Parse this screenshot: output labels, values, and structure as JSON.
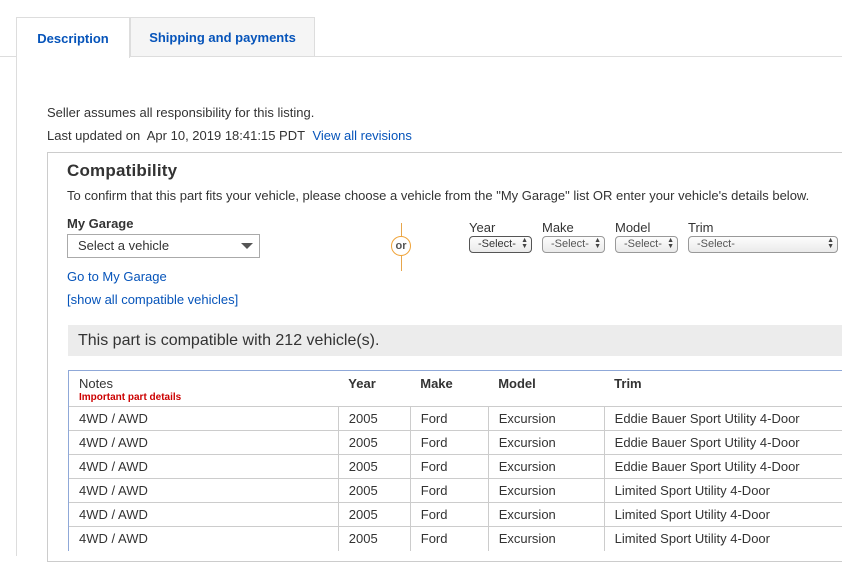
{
  "tabs": [
    {
      "label": "Description",
      "active": true
    },
    {
      "label": "Shipping and payments",
      "active": false
    }
  ],
  "seller_note": "Seller assumes all responsibility for this listing.",
  "last_updated": {
    "label": "Last updated on",
    "value": "Apr 10, 2019 18:41:15 PDT",
    "link": "View all revisions"
  },
  "compatibility": {
    "title": "Compatibility",
    "description": "To confirm that this part fits your vehicle, please choose a vehicle from the \"My Garage\" list OR enter your vehicle's details below.",
    "garage_label": "My Garage",
    "garage_placeholder": "Select a vehicle",
    "goto_link": "Go to My Garage",
    "show_all_link": "[show all compatible vehicles]",
    "or_text": "or",
    "selectors": [
      {
        "label": "Year",
        "value": "-Select-"
      },
      {
        "label": "Make",
        "value": "-Select-"
      },
      {
        "label": "Model",
        "value": "-Select-"
      },
      {
        "label": "Trim",
        "value": "-Select-"
      }
    ],
    "banner": "This part is compatible with 212 vehicle(s).",
    "table": {
      "headers": {
        "notes": "Notes",
        "notes_sub": "Important part details",
        "year": "Year",
        "make": "Make",
        "model": "Model",
        "trim": "Trim"
      },
      "rows": [
        {
          "notes": "4WD / AWD",
          "year": "2005",
          "make": "Ford",
          "model": "Excursion",
          "trim": "Eddie Bauer Sport Utility 4-Door"
        },
        {
          "notes": "4WD / AWD",
          "year": "2005",
          "make": "Ford",
          "model": "Excursion",
          "trim": "Eddie Bauer Sport Utility 4-Door"
        },
        {
          "notes": "4WD / AWD",
          "year": "2005",
          "make": "Ford",
          "model": "Excursion",
          "trim": "Eddie Bauer Sport Utility 4-Door"
        },
        {
          "notes": "4WD / AWD",
          "year": "2005",
          "make": "Ford",
          "model": "Excursion",
          "trim": "Limited Sport Utility 4-Door"
        },
        {
          "notes": "4WD / AWD",
          "year": "2005",
          "make": "Ford",
          "model": "Excursion",
          "trim": "Limited Sport Utility 4-Door"
        },
        {
          "notes": "4WD / AWD",
          "year": "2005",
          "make": "Ford",
          "model": "Excursion",
          "trim": "Limited Sport Utility 4-Door"
        }
      ]
    }
  }
}
